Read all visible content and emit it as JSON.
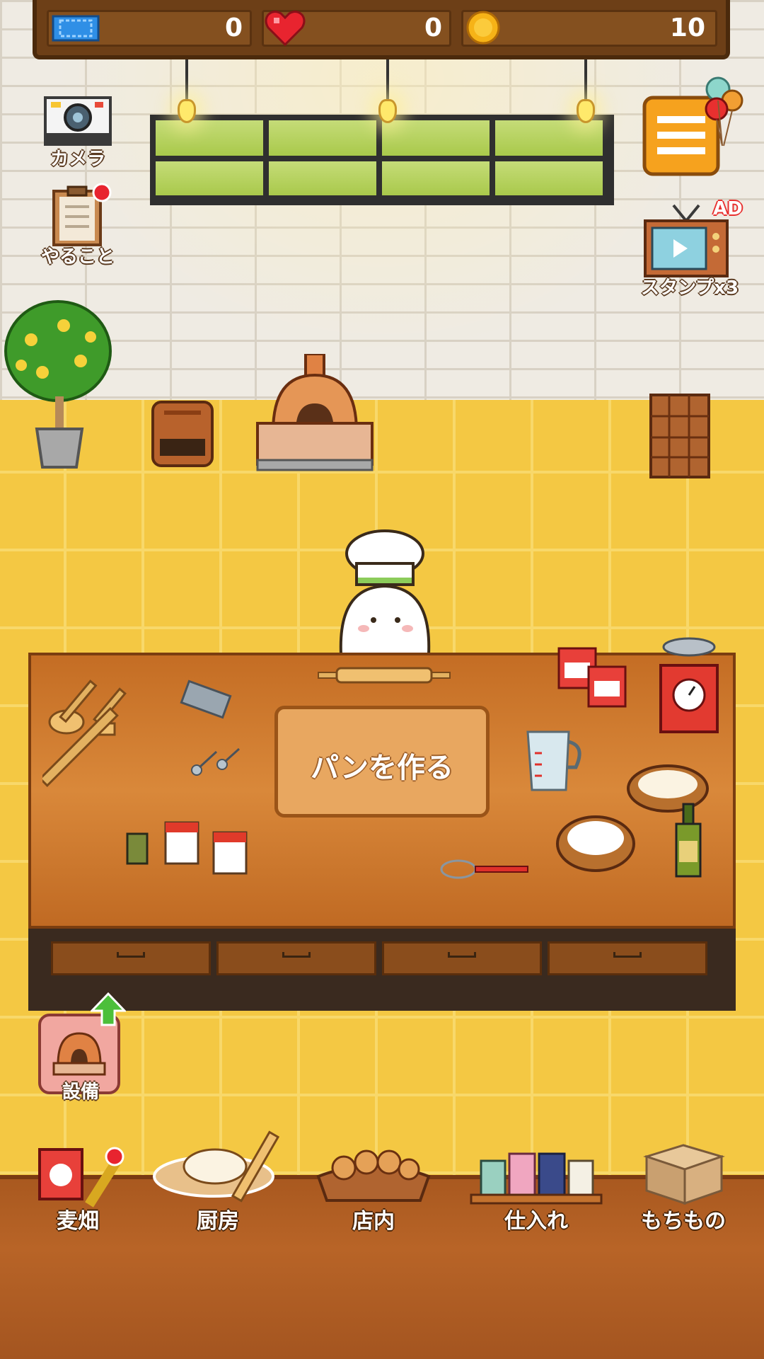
{
  "hud": {
    "tickets": "0",
    "hearts": "0",
    "coins": "10"
  },
  "side_buttons": {
    "camera": "カメラ",
    "todo": "やること",
    "stamp_ad_badge": "AD",
    "stamp": "スタンプx3",
    "equipment": "設備"
  },
  "counter": {
    "make_bread": "パンを作る"
  },
  "nav": {
    "wheat_field": "麦畑",
    "kitchen": "厨房",
    "store": "店内",
    "purchase": "仕入れ",
    "inventory": "もちもの"
  },
  "icons": [
    "ticket-icon",
    "heart-icon",
    "coin-icon",
    "camera-icon",
    "todo-clipboard-icon",
    "menu-icon",
    "balloons-icon",
    "tv-icon",
    "oven-icon",
    "chef-cat",
    "rolling-pin",
    "scale-icon"
  ],
  "colors": {
    "floor": "#f4c843",
    "wall": "#efebe3",
    "wood": "#b86427",
    "counter": "#d9883a"
  }
}
